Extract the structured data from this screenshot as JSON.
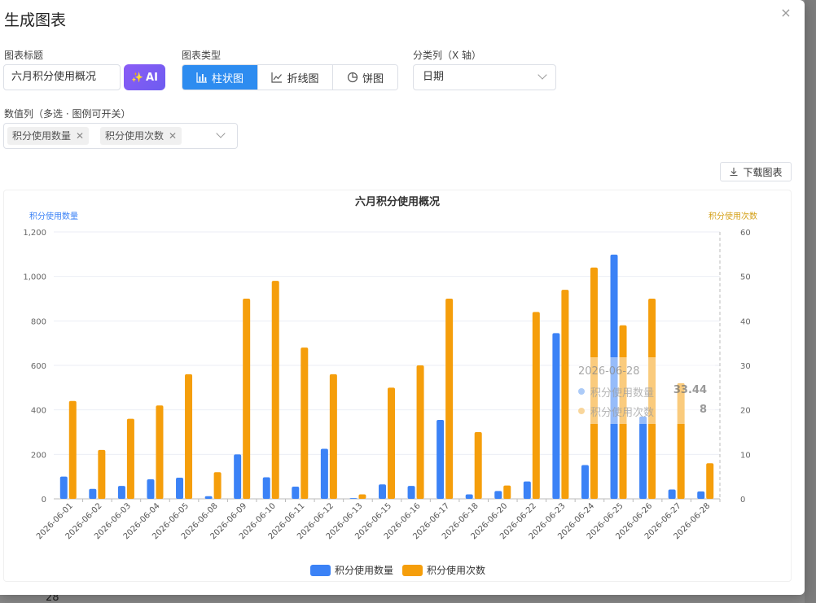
{
  "dialog": {
    "title": "生成图表",
    "close_icon": "×"
  },
  "form": {
    "title_label": "图表标题",
    "title_value": "六月积分使用概况",
    "ai_label": "AI",
    "ai_icon": "✨",
    "type_label": "图表类型",
    "types": [
      {
        "label": "柱状图",
        "icon": "bar-chart-icon",
        "active": true
      },
      {
        "label": "折线图",
        "icon": "line-chart-icon",
        "active": false
      },
      {
        "label": "饼图",
        "icon": "pie-chart-icon",
        "active": false
      }
    ],
    "category_label": "分类列（X 轴）",
    "category_value": "日期",
    "value_label": "数值列（多选 · 图例可开关）",
    "value_tags": [
      "积分使用数量",
      "积分使用次数"
    ],
    "download_label": "下载图表"
  },
  "under_text": "28",
  "colors": {
    "series1": "#3b82f6",
    "series2": "#f59e0b",
    "active": "#2d8cf0"
  },
  "chart_data": {
    "type": "bar",
    "title": "六月积分使用概况",
    "categories": [
      "2026-06-01",
      "2026-06-02",
      "2026-06-03",
      "2026-06-04",
      "2026-06-05",
      "2026-06-08",
      "2026-06-09",
      "2026-06-10",
      "2026-06-11",
      "2026-06-12",
      "2026-06-13",
      "2026-06-15",
      "2026-06-16",
      "2026-06-17",
      "2026-06-18",
      "2026-06-20",
      "2026-06-22",
      "2026-06-23",
      "2026-06-24",
      "2026-06-25",
      "2026-06-26",
      "2026-06-27",
      "2026-06-28"
    ],
    "series": [
      {
        "name": "积分使用数量",
        "axis": "left",
        "values": [
          100,
          45,
          58,
          88,
          95,
          12,
          200,
          97,
          55,
          225,
          3,
          65,
          58,
          355,
          20,
          35,
          78,
          745,
          152,
          1098,
          370,
          42,
          33.44
        ]
      },
      {
        "name": "积分使用次数",
        "axis": "right",
        "values": [
          22,
          11,
          18,
          21,
          28,
          6,
          45,
          49,
          34,
          28,
          1,
          25,
          30,
          45,
          15,
          3,
          42,
          47,
          52,
          39,
          45,
          26,
          8
        ]
      }
    ],
    "y_left": {
      "label": "积分使用数量",
      "min": 0,
      "max": 1200,
      "ticks": [
        0,
        200,
        400,
        600,
        800,
        1000,
        1200
      ],
      "tick_labels": [
        "0",
        "200",
        "400",
        "600",
        "800",
        "1,000",
        "1,200"
      ]
    },
    "y_right": {
      "label": "积分使用次数",
      "min": 0,
      "max": 60,
      "ticks": [
        0,
        10,
        20,
        30,
        40,
        50,
        60
      ]
    },
    "grid": true,
    "legend": "bottom-center",
    "hover": {
      "category": "2026-06-28",
      "values": [
        "33.44",
        "8"
      ]
    }
  }
}
